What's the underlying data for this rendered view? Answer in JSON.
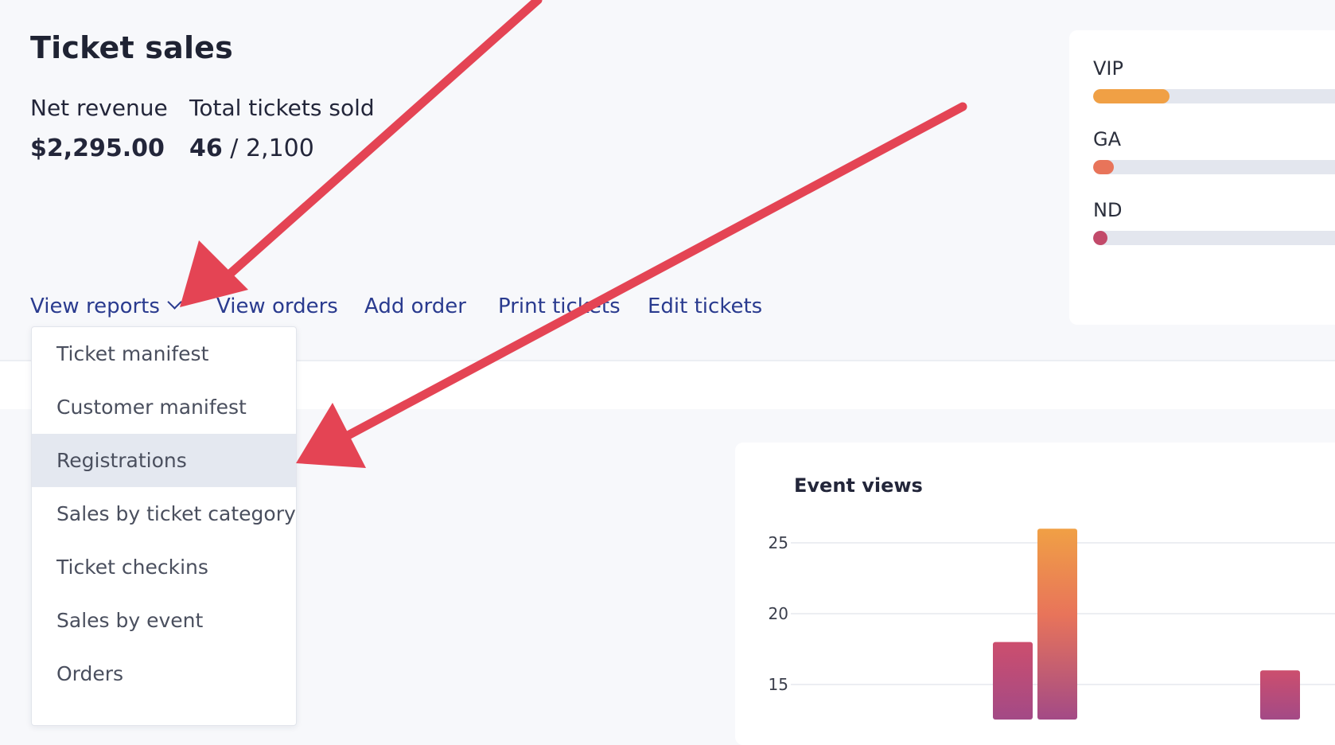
{
  "page": {
    "title": "Ticket sales"
  },
  "stats": {
    "net_revenue_label": "Net revenue",
    "net_revenue_value": "$2,295.00",
    "tickets_label": "Total tickets sold",
    "tickets_sold": "46",
    "tickets_total": "/ 2,100"
  },
  "actions": [
    {
      "label": "View reports"
    },
    {
      "label": "View orders"
    },
    {
      "label": "Add order"
    },
    {
      "label": "Print tickets"
    },
    {
      "label": "Edit tickets"
    }
  ],
  "reports_menu": {
    "items": [
      {
        "label": "Ticket manifest",
        "active": false
      },
      {
        "label": "Customer manifest",
        "active": false
      },
      {
        "label": "Registrations",
        "active": true
      },
      {
        "label": "Sales by ticket category",
        "active": false
      },
      {
        "label": "Ticket checkins",
        "active": false
      },
      {
        "label": "Sales by event",
        "active": false
      },
      {
        "label": "Orders",
        "active": false
      }
    ]
  },
  "categories": [
    {
      "label": "VIP",
      "fill": 0.29,
      "color": "#f0a045"
    },
    {
      "label": "GA",
      "fill": 0.08,
      "color": "#e8745a"
    },
    {
      "label": "ND",
      "fill": 0.02,
      "color": "#c24a6a"
    }
  ],
  "chart_data": {
    "type": "bar",
    "title": "Event views",
    "y_ticks": [
      "25",
      "20",
      "15"
    ],
    "ylim": [
      10,
      27
    ],
    "bars": [
      {
        "value": 18,
        "style": "pink"
      },
      {
        "value": 26,
        "style": "orange"
      },
      {
        "value": 16,
        "style": "pink"
      }
    ],
    "grid": true,
    "colors": {
      "orange_top": "#f0a045",
      "mid": "#e8745a",
      "pink_top": "#cc4e6e",
      "bottom": "#a34a86"
    }
  },
  "annotation": {
    "arrow_color": "#e44454"
  }
}
